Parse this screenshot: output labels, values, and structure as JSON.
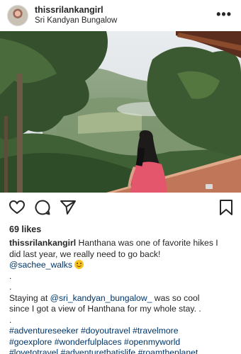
{
  "post": {
    "username": "thissrilankangirl",
    "location": "Sri Kandyan Bungalow",
    "likes": "69 likes"
  },
  "icons": {
    "more": "more-options-icon",
    "like": "heart-icon",
    "comment": "comment-icon",
    "share": "send-icon",
    "save": "bookmark-icon",
    "smile": "smiling-face-emoji"
  },
  "caption": {
    "username": "thissrilankangirl",
    "line1_rest": " Hanthana was one of favorite hikes I",
    "line2": "did last year, we really need to go back!",
    "mention1": "@sachee_walks",
    "dot1": ".",
    "dot2": ".",
    "stay_prefix": "Staying at ",
    "mention2": "@sri_kandyan_bungalow_",
    "stay_suffix": " was so cool",
    "stay_line2": "since I got a view of Hanthana for my whole stay. .",
    "dot3": ".",
    "hashtags1": "#adventureseeker #doyoutravel #travelmore",
    "hashtags2": "#goexplore #wonderfulplaces #openmyworld",
    "hashtags3": "#lovetotravel #adventurethatislife #roamtheplanet"
  },
  "colors": {
    "link": "#003569",
    "text": "#262626"
  }
}
